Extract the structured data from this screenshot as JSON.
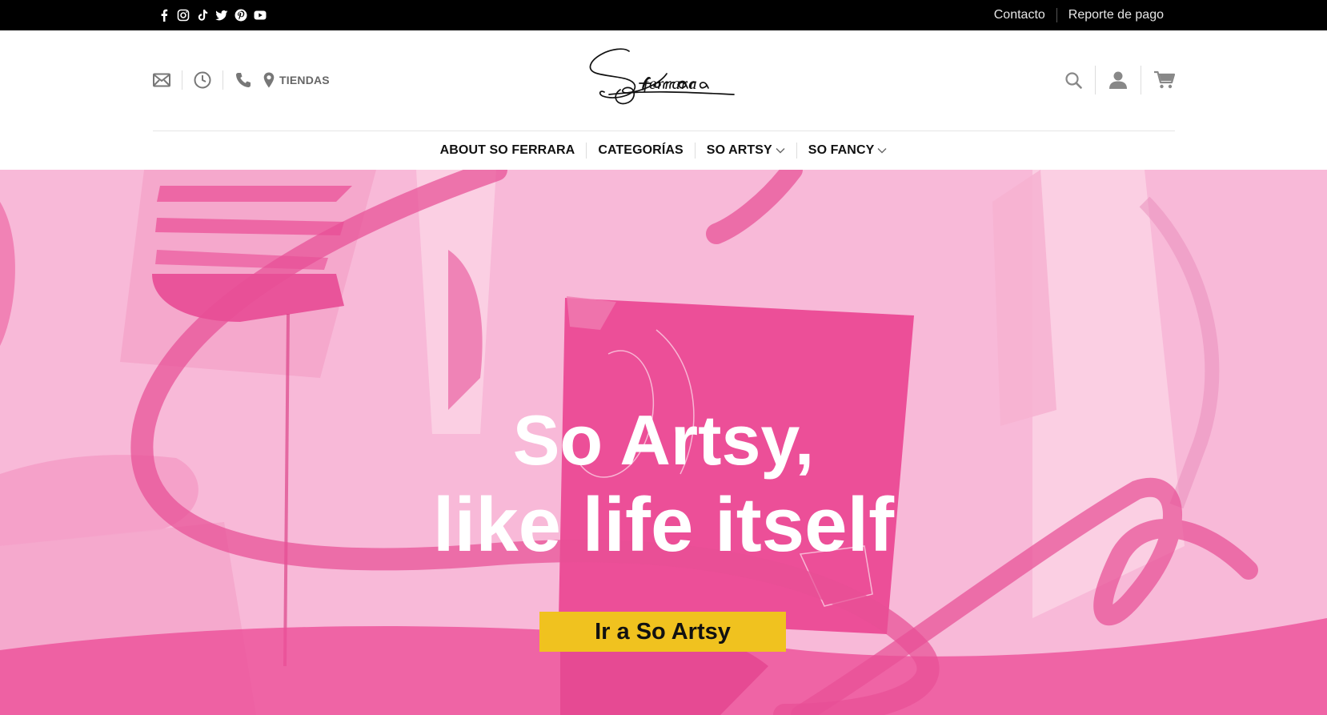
{
  "topbar": {
    "social_icons": [
      "facebook-icon",
      "instagram-icon",
      "tiktok-icon",
      "twitter-icon",
      "pinterest-icon",
      "youtube-icon"
    ],
    "links": [
      {
        "label": "Contacto"
      },
      {
        "label": "Reporte de pago"
      }
    ]
  },
  "header": {
    "left_icons": [
      "mail-icon",
      "clock-icon",
      "phone-icon"
    ],
    "stores_label": "TIENDAS",
    "logo_text": "So Ferrara",
    "right_icons": [
      "search-icon",
      "user-icon",
      "cart-icon"
    ]
  },
  "nav": {
    "items": [
      {
        "label": "ABOUT SO FERRARA",
        "dropdown": false
      },
      {
        "label": "CATEGORÍAS",
        "dropdown": false
      },
      {
        "label": "SO ARTSY",
        "dropdown": true
      },
      {
        "label": "SO FANCY",
        "dropdown": true
      }
    ]
  },
  "hero": {
    "title_line1": "So Artsy,",
    "title_line2": "like life itself",
    "cta_label": "Ir a So Artsy"
  },
  "colors": {
    "topbar_bg": "#000000",
    "hero_pink": "#f7b6d6",
    "hero_accent": "#ec4f98",
    "cta_yellow": "#f0c21f"
  }
}
